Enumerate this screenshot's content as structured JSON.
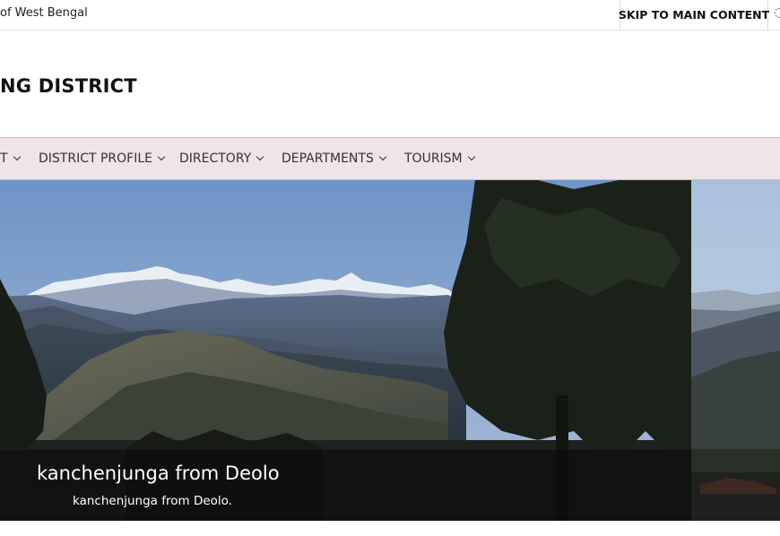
{
  "topbar": {
    "government_text": "of West Bengal",
    "skip_label": "SKIP TO MAIN CONTENT"
  },
  "header": {
    "site_title": "NG DISTRICT"
  },
  "nav": {
    "items": [
      {
        "label": "T"
      },
      {
        "label": "DISTRICT PROFILE"
      },
      {
        "label": "DIRECTORY"
      },
      {
        "label": "DEPARTMENTS"
      },
      {
        "label": "TOURISM"
      }
    ]
  },
  "slider": {
    "current": {
      "title": "kanchenjunga from Deolo",
      "description": "kanchenjunga from Deolo."
    }
  },
  "colors": {
    "nav_background": "#efe4e6",
    "caption_overlay": "rgba(10,10,10,0.62)"
  }
}
